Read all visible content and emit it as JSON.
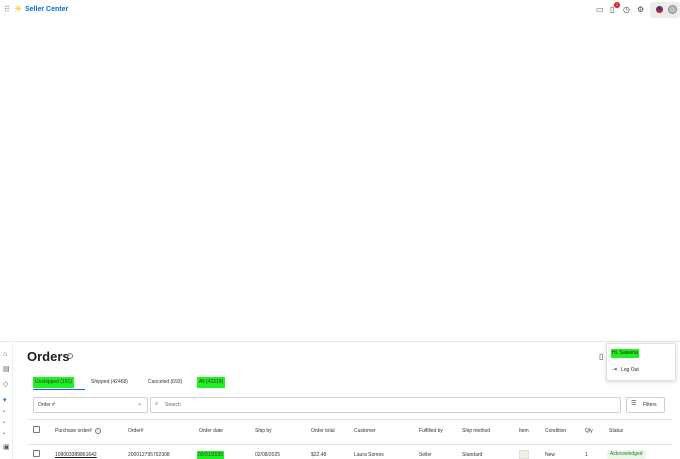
{
  "app": {
    "brand": "Seller Center"
  },
  "topbar": {
    "icons": [
      "grid-icon",
      "spark-icon",
      "message-icon",
      "bell-icon",
      "help-icon",
      "gear-icon",
      "flag-icon",
      "avatar"
    ],
    "notification_count": "1"
  },
  "sidebar": {
    "icons": [
      "home-icon",
      "catalog-icon",
      "tag-icon",
      "cart-icon",
      "bullet-icon",
      "bullet-icon",
      "bullet-icon",
      "store-icon"
    ]
  },
  "page": {
    "title": "Orders"
  },
  "user_menu": {
    "greeting": "Hi, Saleena",
    "logout": "Log Out"
  },
  "tabs": [
    {
      "label": "Unshipped (191)",
      "highlighted": true,
      "active": true
    },
    {
      "label": "Shipped (42468)",
      "highlighted": false,
      "active": false
    },
    {
      "label": "Canceled (693)",
      "highlighted": false,
      "active": false
    },
    {
      "label": "All (43319)",
      "highlighted": true,
      "active": false
    }
  ],
  "filters": {
    "order_select": "Order #",
    "search_placeholder": "Search",
    "filters_label": "Filters"
  },
  "table": {
    "columns": [
      "Purchase order#",
      "Order#",
      "Order date",
      "Ship by",
      "Order total",
      "Customer",
      "Fulfilled by",
      "Ship method",
      "Item",
      "Condition",
      "Qty",
      "Status"
    ],
    "rows": [
      {
        "purchase_order": "109003389861642",
        "order": "200012795792308",
        "order_date": "02/01/2025",
        "ship_by": "02/08/2025",
        "order_total": "$22.48",
        "customer": "Laura Somes",
        "fulfilled_by": "Seller",
        "ship_method": "Standard",
        "condition": "New",
        "qty": "1",
        "status": "Acknowledged"
      }
    ]
  },
  "colors": {
    "accent": "#0071dc",
    "highlight": "#21f021",
    "spark": "#ffc220",
    "badge": "#de1c24"
  }
}
